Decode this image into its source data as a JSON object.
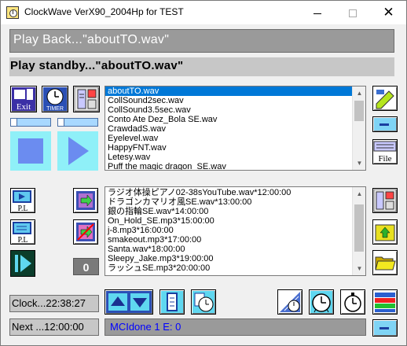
{
  "window": {
    "title": "ClockWave VerX90_2004Hp for TEST",
    "minimize_glyph": "",
    "close_glyph": "✕"
  },
  "playback": {
    "text": "Play Back...\"aboutTO.wav\""
  },
  "standby": {
    "text": "Play standby...\"aboutTO.wav\""
  },
  "toolbar_left": {
    "exit_label": "Exit",
    "timer_label": "TIMER"
  },
  "play_list": {
    "selected_index": 0,
    "items": [
      "aboutTO.wav",
      "CollSound2sec.wav",
      "CollSound3.5sec.wav",
      "Conto Ate Dez_Bola SE.wav",
      "CrawdadS.wav",
      "Eyelevel.wav",
      "HappyFNT.wav",
      "Letesy.wav",
      "Puff the magic dragon_SE.wav"
    ]
  },
  "schedule_list": {
    "items": [
      "ラジオ体操ピアノ02-38sYouTube.wav*12:00:00",
      "ドラゴンカマリオ風SE.wav*13:00:00",
      "銀の指輪SE.wav*14:00:00",
      "On_Hold_SE.mp3*15:00:00",
      "j-8.mp3*16:00:00",
      "smakeout.mp3*17:00:00",
      "Santa.wav*18:00:00",
      "Sleepy_Jake.mp3*19:00:00",
      "ラッシュSE.mp3*20:00:00"
    ]
  },
  "left_panel": {
    "pl_label_1": "P.L",
    "pl_label_2": "P.L",
    "counter": "0"
  },
  "right_panel": {
    "file_label": "File"
  },
  "footer": {
    "clock": "Clock...22:38:27",
    "next": "Next ...12:00:00",
    "mci_status": "MCIdone  1 E: 0"
  },
  "colors": {
    "accent_blue": "#0078d7",
    "cyan": "#00ffff",
    "panel_gray": "#9a9a9a",
    "light_gray": "#c7c7c7",
    "play_blue": "#6b8cf0"
  }
}
